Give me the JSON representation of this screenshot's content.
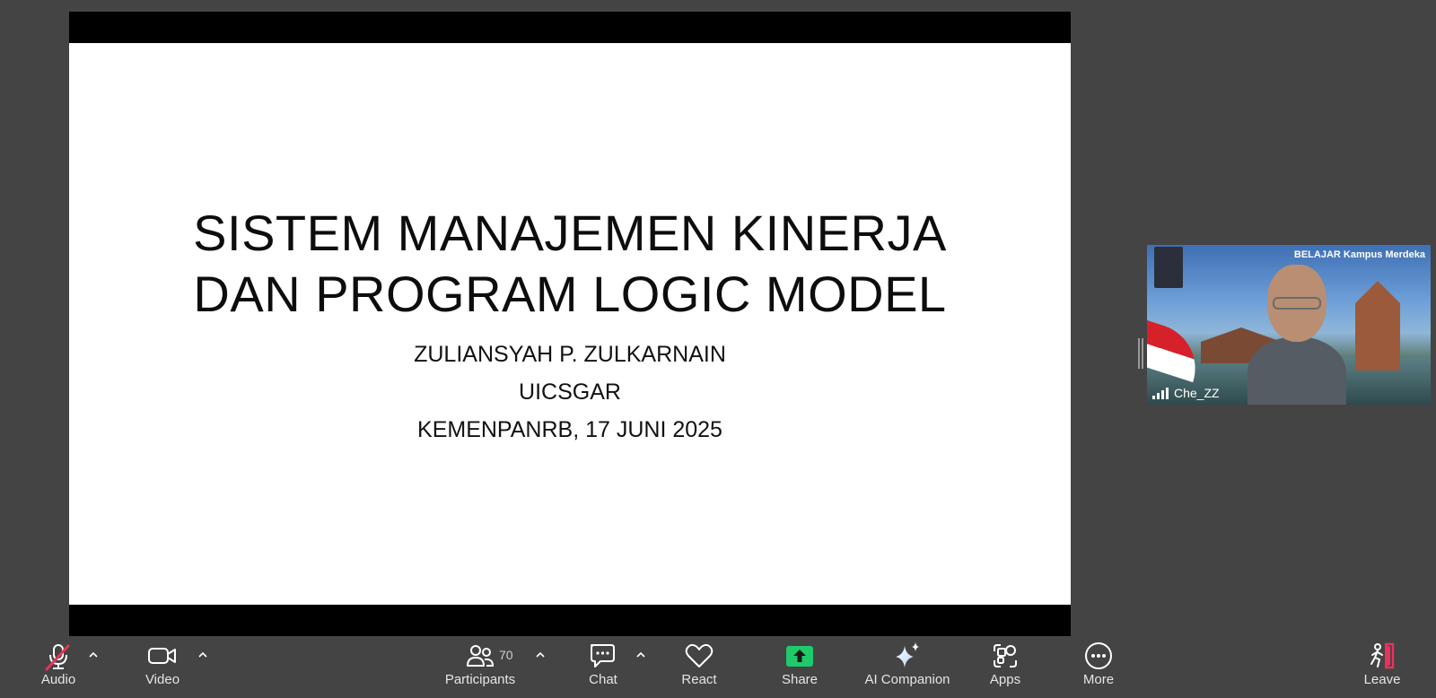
{
  "slide": {
    "title_line1": "SISTEM MANAJEMEN KINERJA",
    "title_line2": "DAN PROGRAM LOGIC MODEL",
    "presenter": "ZULIANSYAH P. ZULKARNAIN",
    "organization": "UICSGAR",
    "event": "KEMENPANRB, 17 JUNI 2025"
  },
  "video_tile": {
    "participant_name": "Che_ZZ",
    "background_text": "BELAJAR Kampus Merdeka"
  },
  "toolbar": {
    "audio_label": "Audio",
    "video_label": "Video",
    "participants_label": "Participants",
    "participants_count": "70",
    "chat_label": "Chat",
    "react_label": "React",
    "share_label": "Share",
    "ai_companion_label": "AI Companion",
    "apps_label": "Apps",
    "more_label": "More",
    "leave_label": "Leave"
  },
  "colors": {
    "background": "#444444",
    "share_green": "#1fca6b",
    "mute_red": "#e8335a",
    "leave_red": "#e8335a"
  },
  "icons": {
    "audio": "muted-microphone-icon",
    "video": "video-camera-icon",
    "participants": "people-icon",
    "chat": "chat-bubbles-icon",
    "react": "heart-icon",
    "share": "share-arrow-icon",
    "ai": "sparkle-icon",
    "apps": "apps-grid-icon",
    "more": "more-dots-icon",
    "leave": "leave-door-icon"
  }
}
